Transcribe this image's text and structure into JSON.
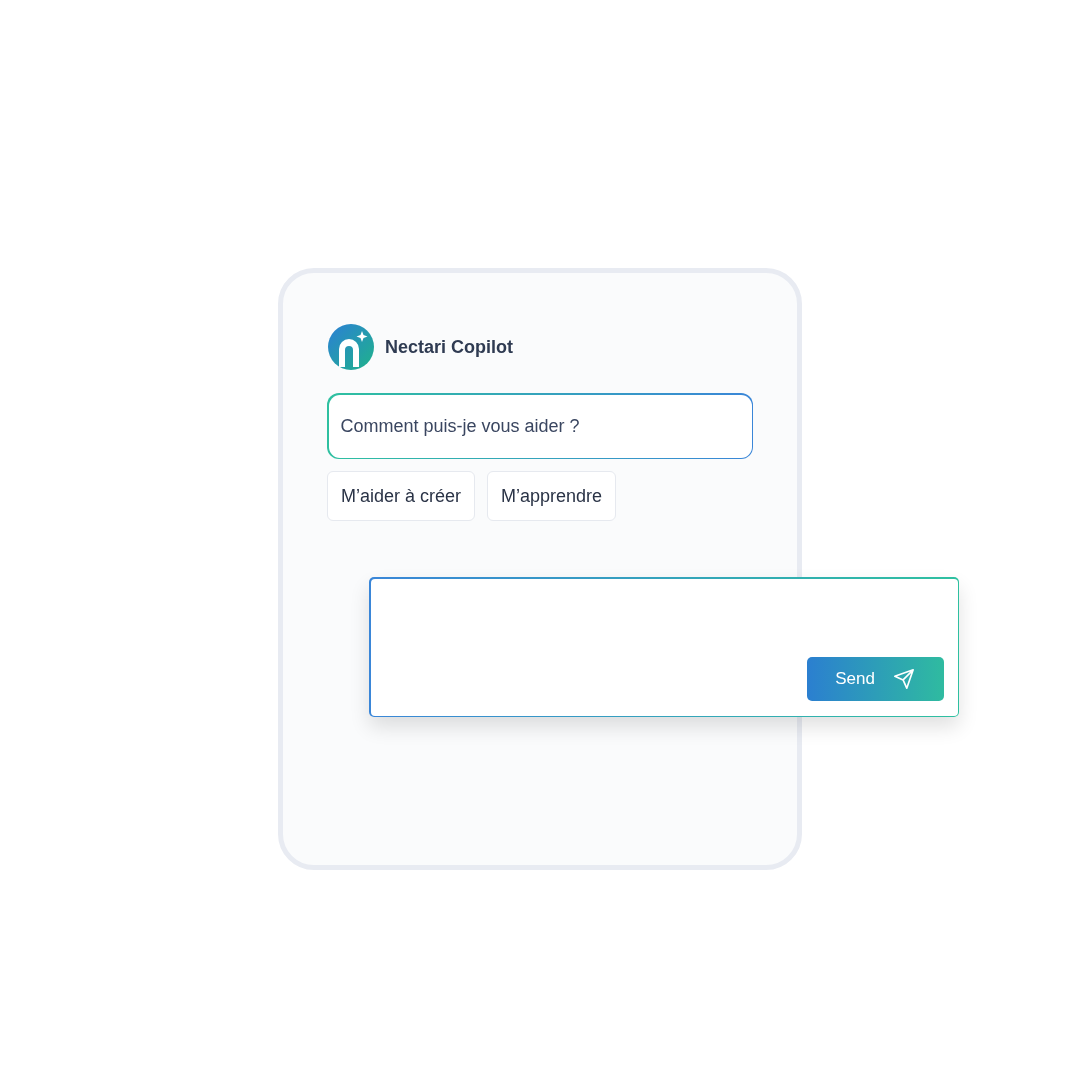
{
  "assistant": {
    "name": "Nectari Copilot"
  },
  "message": {
    "text": "Comment puis-je vous aider ?"
  },
  "suggestions": [
    {
      "label": "M’aider à créer"
    },
    {
      "label": "M’apprendre"
    }
  ],
  "composer": {
    "send_label": "Send"
  }
}
